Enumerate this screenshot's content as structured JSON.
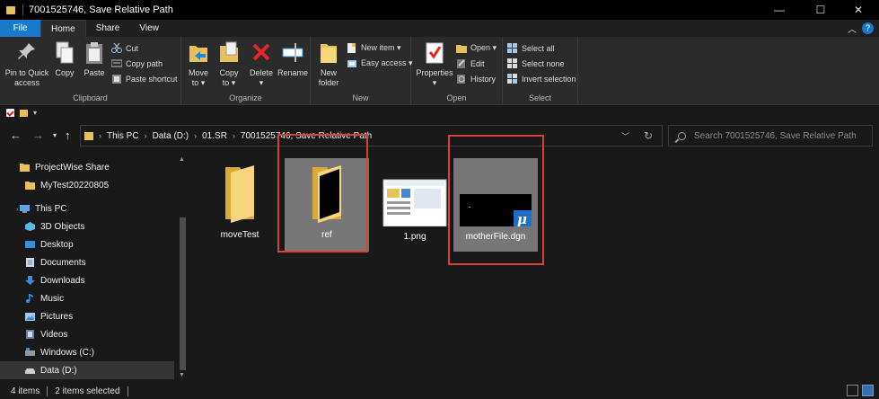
{
  "window": {
    "title": "7001525746, Save Relative Path",
    "minimize": "—",
    "maximize": "☐",
    "close": "✕"
  },
  "tabs": [
    {
      "label": "File"
    },
    {
      "label": "Home"
    },
    {
      "label": "Share"
    },
    {
      "label": "View"
    }
  ],
  "ribbon": {
    "clipboard": {
      "pin": "Pin to Quick\naccess",
      "copy": "Copy",
      "paste": "Paste",
      "cut": "Cut",
      "copy_path": "Copy path",
      "paste_shortcut": "Paste shortcut",
      "label": "Clipboard"
    },
    "organize": {
      "move_to": "Move\nto ▾",
      "copy_to": "Copy\nto ▾",
      "delete": "Delete\n▾",
      "rename": "Rename",
      "label": "Organize"
    },
    "new": {
      "new_folder": "New\nfolder",
      "new_item": "New item ▾",
      "easy_access": "Easy access ▾",
      "label": "New"
    },
    "open": {
      "properties": "Properties\n▾",
      "open": "Open ▾",
      "edit": "Edit",
      "history": "History",
      "label": "Open"
    },
    "select": {
      "select_all": "Select all",
      "select_none": "Select none",
      "invert_selection": "Invert selection",
      "label": "Select"
    }
  },
  "address": {
    "crumbs": [
      "This PC",
      "Data (D:)",
      "01.SR",
      "7001525746, Save Relative Path"
    ]
  },
  "search": {
    "placeholder": "Search 7001525746, Save Relative Path"
  },
  "nav": {
    "items": [
      {
        "label": "ProjectWise Share",
        "icon": "folder-icon"
      },
      {
        "label": "MyTest20220805",
        "icon": "folder-icon"
      },
      {
        "label": "This PC",
        "icon": "computer-icon"
      },
      {
        "label": "3D Objects",
        "icon": "cube-icon"
      },
      {
        "label": "Desktop",
        "icon": "desktop-icon"
      },
      {
        "label": "Documents",
        "icon": "document-icon"
      },
      {
        "label": "Downloads",
        "icon": "download-icon"
      },
      {
        "label": "Music",
        "icon": "music-icon"
      },
      {
        "label": "Pictures",
        "icon": "pictures-icon"
      },
      {
        "label": "Videos",
        "icon": "video-icon"
      },
      {
        "label": "Windows (C:)",
        "icon": "drive-icon"
      },
      {
        "label": "Data (D:)",
        "icon": "drive-icon"
      }
    ]
  },
  "files": [
    {
      "name": "moveTest",
      "type": "folder",
      "selected": false
    },
    {
      "name": "ref",
      "type": "folder",
      "selected": true
    },
    {
      "name": "1.png",
      "type": "image",
      "selected": false
    },
    {
      "name": "motherFile.dgn",
      "type": "dgn",
      "selected": true
    }
  ],
  "status": {
    "count": "4 items",
    "selected": "2 items selected"
  },
  "colors": {
    "accent": "#1979ca",
    "folder": "#e8c15c",
    "highlight_box": "#d9403a"
  }
}
